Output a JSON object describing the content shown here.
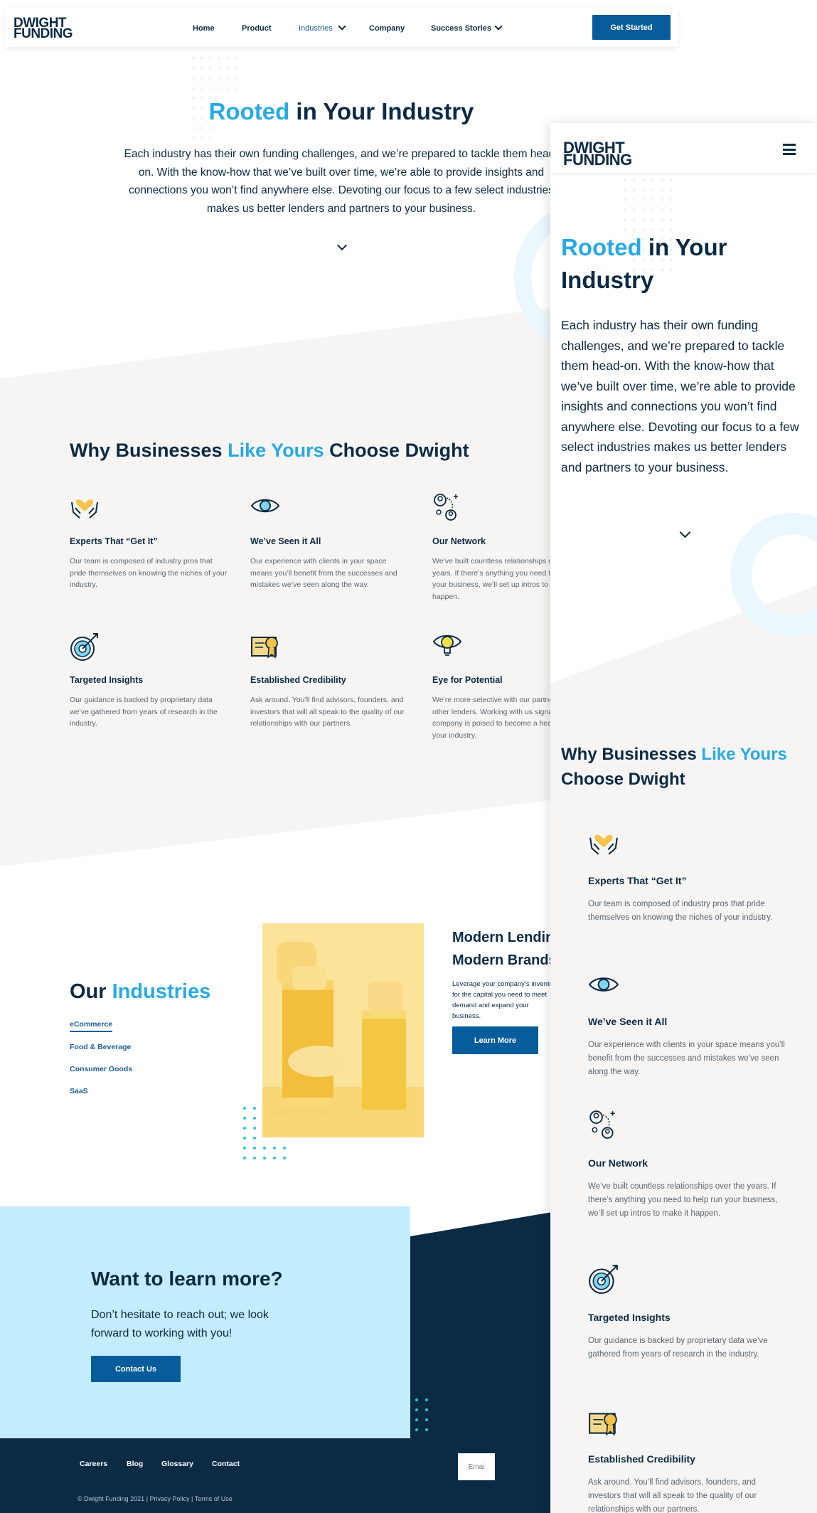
{
  "desktop": {
    "brand": {
      "line1": "DWIGHT",
      "line2": "FUNDING"
    },
    "nav": {
      "home": "Home",
      "product": "Product",
      "industries": "Industries",
      "company": "Company",
      "success_stories": "Success Stories",
      "cta": "Get Started"
    },
    "hero": {
      "title_accent": "Rooted",
      "title_rest": " in Your Industry",
      "text": "Each industry has their own funding challenges, and we’re prepared to tackle them head-on. With the know-how that we’ve built over time, we’re able to provide insights and connections you won’t find anywhere else. Devoting our focus to a few select industries makes us better lenders and partners to your business."
    },
    "why": {
      "title_pre": "Why Businesses ",
      "title_accent": "Like Yours",
      "title_post": " Choose Dwight",
      "features": [
        {
          "title": "Experts That “Get It”",
          "text": "Our team is composed of industry pros that pride themselves on knowing the niches of your industry.",
          "icon": "hands-heart-icon"
        },
        {
          "title": "We’ve Seen it All",
          "text": "Our experience with clients in your space means you’ll benefit from the successes and mistakes we’ve seen along the way.",
          "icon": "eye-icon"
        },
        {
          "title": "Our Network",
          "text": "We’ve built countless relationships over the years. If there’s anything you need to help run your business, we’ll set up intros to make it happen.",
          "icon": "network-icon"
        },
        {
          "title": "Targeted Insights",
          "text": "Our guidance is backed by proprietary data we’ve gathered from years of research in the industry.",
          "icon": "target-icon"
        },
        {
          "title": "Established Credibility",
          "text": "Ask around. You’ll find advisors, founders, and investors that will all speak to the quality of our relationships with our partners.",
          "icon": "certificate-icon"
        },
        {
          "title": "Eye for Potential",
          "text": "We’re more selective with our partners than other lenders. Working with us signals that your company is poised to become a heavyweight in your industry.",
          "icon": "lightbulb-eye-icon"
        }
      ]
    },
    "industries": {
      "title_pre": "Our ",
      "title_accent": "Industries",
      "links": [
        "eCommerce",
        "Food & Beverage",
        "Consumer Goods",
        "SaaS"
      ],
      "feature_title": "Modern Lending for Modern Brands",
      "feature_text": "Leverage your company’s inventory for the capital you need to meet demand and expand your business.",
      "button": "Learn More"
    },
    "cta": {
      "title": "Want to learn more?",
      "text": "Don’t hesitate to reach out; we look forward to working with you!",
      "button": "Contact Us"
    },
    "footer": {
      "links": [
        "Careers",
        "Blog",
        "Glossary",
        "Contact"
      ],
      "email_placeholder": "Emai",
      "copyright": "© Dwight Funding 2021 | Privacy Policy | Terms of Use"
    }
  },
  "mobile": {
    "brand": {
      "line1": "DWIGHT",
      "line2": "FUNDING"
    },
    "menu_icon": "hamburger-icon",
    "hero": {
      "title_accent": "Rooted",
      "title_rest": " in Your Industry",
      "text": "Each industry has their own funding challenges, and we’re prepared to tackle them head-on. With the know-how that we’ve built over time, we’re able to provide insights and connections you won’t find anywhere else. Devoting our focus to a few select industries makes us better lenders and partners to your business."
    },
    "why": {
      "title_pre": "Why Businesses ",
      "title_accent": "Like Yours",
      "title_post": "Choose Dwight",
      "features": [
        {
          "title": "Experts That “Get It”",
          "text": "Our team is composed of industry pros that pride themselves on knowing the niches of your industry."
        },
        {
          "title": "We’ve Seen it All",
          "text": "Our experience with clients in your space means you’ll benefit from the successes and mistakes we’ve seen along the way."
        },
        {
          "title": "Our Network",
          "text": "We’ve built countless relationships over the years. If there’s anything you need to help run your business, we’ll set up intros to make it happen."
        },
        {
          "title": "Targeted Insights",
          "text": "Our guidance is backed by proprietary data we’ve gathered from years of research in the industry."
        },
        {
          "title": "Established Credibility",
          "text": "Ask around. You’ll find advisors, founders, and investors that will all speak to the quality of our relationships with our partners."
        }
      ]
    }
  },
  "colors": {
    "navy": "#0b2a44",
    "accent": "#27aae1",
    "button": "#075c9b",
    "light_blue": "#c3ecfc",
    "gray_band": "#f6f5f3",
    "gold": "#f5c24a"
  }
}
